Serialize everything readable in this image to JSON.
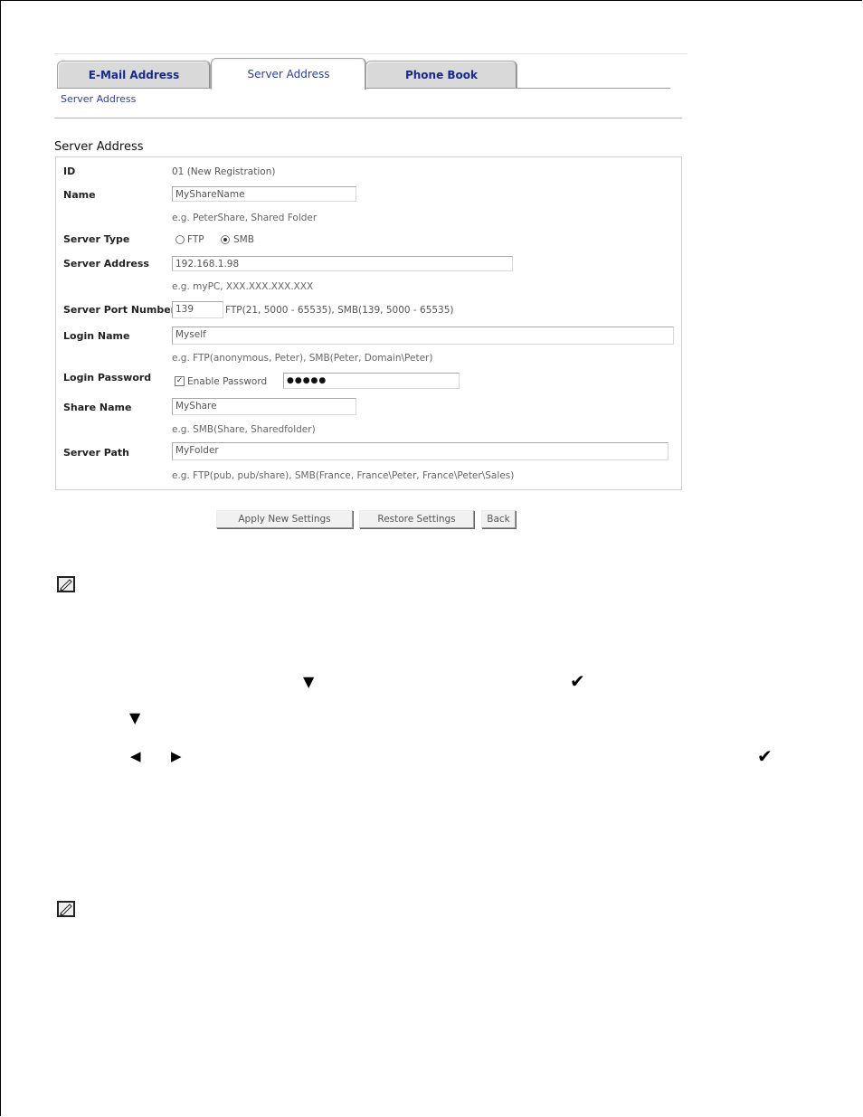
{
  "tabs": [
    {
      "label": "E-Mail Address",
      "active": false
    },
    {
      "label": "Server Address",
      "active": true
    },
    {
      "label": "Phone Book",
      "active": false
    }
  ],
  "breadcrumb": "Server Address",
  "section_title": "Server Address",
  "form": {
    "id": {
      "label": "ID",
      "value": "01 (New Registration)"
    },
    "name": {
      "label": "Name",
      "value": "MyShareName",
      "hint": "e.g. PeterShare, Shared Folder"
    },
    "server_type": {
      "label": "Server Type",
      "options": [
        "FTP",
        "SMB"
      ],
      "selected": "SMB"
    },
    "server_address": {
      "label": "Server Address",
      "value": "192.168.1.98",
      "hint": "e.g. myPC, XXX.XXX.XXX.XXX"
    },
    "server_port": {
      "label": "Server Port Number",
      "value": "139",
      "hint": "FTP(21, 5000 - 65535), SMB(139, 5000 - 65535)"
    },
    "login_name": {
      "label": "Login Name",
      "value": "Myself",
      "hint": "e.g. FTP(anonymous, Peter), SMB(Peter, Domain\\Peter)"
    },
    "login_password": {
      "label": "Login Password",
      "checkbox_label": "Enable Password",
      "checked": true,
      "value": "●●●●●"
    },
    "share_name": {
      "label": "Share Name",
      "value": "MyShare",
      "hint": "e.g. SMB(Share, Sharedfolder)"
    },
    "server_path": {
      "label": "Server Path",
      "value": "MyFolder",
      "hint": "e.g. FTP(pub, pub/share), SMB(France, France\\Peter, France\\Peter\\Sales)"
    }
  },
  "buttons": {
    "apply": "Apply New Settings",
    "restore": "Restore Settings",
    "back": "Back"
  },
  "glyphs": {
    "down": "▼",
    "check": "✔",
    "left": "◀",
    "right": "▶"
  },
  "icons": [
    "note-icon",
    "down-arrow-icon",
    "check-icon",
    "left-arrow-icon",
    "right-arrow-icon"
  ]
}
